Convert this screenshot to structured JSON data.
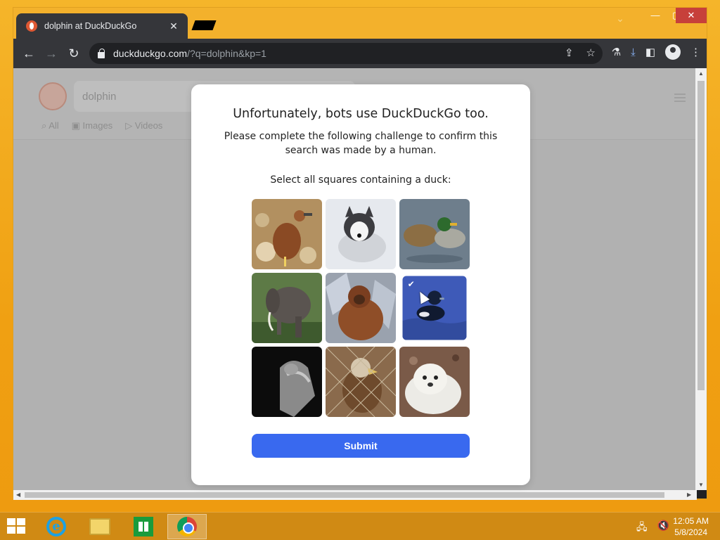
{
  "browser": {
    "tab_title": "dolphin at DuckDuckGo",
    "url_host": "duckduckgo.com",
    "url_rest": "/?q=dolphin&kp=1"
  },
  "ddg": {
    "search_value": "dolphin",
    "tabs": [
      "All",
      "Images",
      "Videos"
    ]
  },
  "captcha": {
    "heading": "Unfortunately, bots use DuckDuckGo too.",
    "subtext": "Please complete the following challenge to confirm this search was made by a human.",
    "prompt": "Select all squares containing a duck:",
    "submit_label": "Submit",
    "tiles": [
      {
        "subject": "whistling-duck",
        "selected": false
      },
      {
        "subject": "husky-dog",
        "selected": false
      },
      {
        "subject": "mallard-ducks",
        "selected": false
      },
      {
        "subject": "elephant",
        "selected": false
      },
      {
        "subject": "orangutan",
        "selected": false
      },
      {
        "subject": "tufted-duck",
        "selected": true
      },
      {
        "subject": "cat-in-dark",
        "selected": false
      },
      {
        "subject": "eagle-behind-fence",
        "selected": false
      },
      {
        "subject": "seal-pup",
        "selected": false
      }
    ]
  },
  "taskbar": {
    "time": "12:05 AM",
    "date": "5/8/2024"
  },
  "colors": {
    "desktop": "#f0a412",
    "submit": "#3969ef",
    "chrome_toolbar": "#35363a"
  }
}
